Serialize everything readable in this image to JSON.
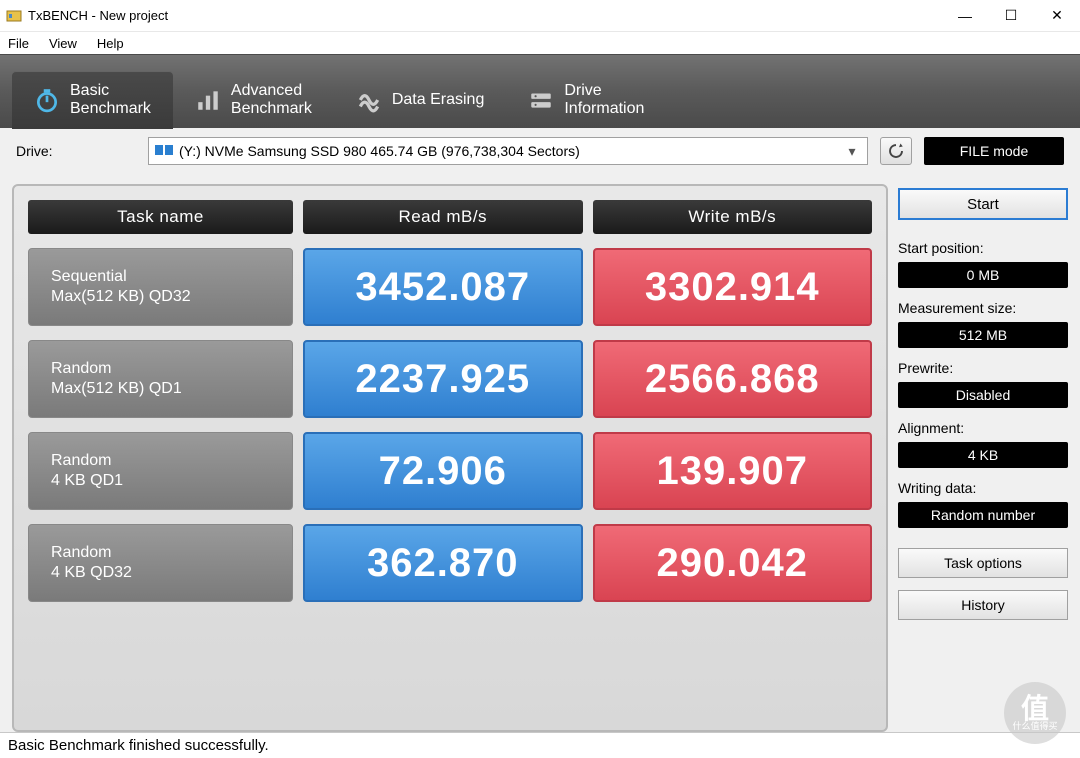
{
  "window": {
    "title": "TxBENCH - New project",
    "minimize": "—",
    "maximize": "☐",
    "close": "✕"
  },
  "menu": {
    "file": "File",
    "view": "View",
    "help": "Help"
  },
  "tabs": {
    "basic": "Basic\nBenchmark",
    "advanced": "Advanced\nBenchmark",
    "erasing": "Data Erasing",
    "drive_info": "Drive\nInformation"
  },
  "drive": {
    "label": "Drive:",
    "selected": "(Y:) NVMe Samsung SSD 980  465.74 GB (976,738,304 Sectors)",
    "file_mode": "FILE mode"
  },
  "headers": {
    "task": "Task name",
    "read": "Read mB/s",
    "write": "Write mB/s"
  },
  "rows": [
    {
      "name1": "Sequential",
      "name2": "Max(512 KB) QD32",
      "read": "3452.087",
      "write": "3302.914"
    },
    {
      "name1": "Random",
      "name2": "Max(512 KB) QD1",
      "read": "2237.925",
      "write": "2566.868"
    },
    {
      "name1": "Random",
      "name2": "4 KB QD1",
      "read": "72.906",
      "write": "139.907"
    },
    {
      "name1": "Random",
      "name2": "4 KB QD32",
      "read": "362.870",
      "write": "290.042"
    }
  ],
  "side": {
    "start": "Start",
    "start_pos_label": "Start position:",
    "start_pos": "0 MB",
    "meas_size_label": "Measurement size:",
    "meas_size": "512 MB",
    "prewrite_label": "Prewrite:",
    "prewrite": "Disabled",
    "alignment_label": "Alignment:",
    "alignment": "4 KB",
    "writing_data_label": "Writing data:",
    "writing_data": "Random number",
    "task_options": "Task options",
    "history": "History"
  },
  "status": "Basic Benchmark finished successfully.",
  "watermark": {
    "char": "值",
    "text": "什么值得买"
  }
}
